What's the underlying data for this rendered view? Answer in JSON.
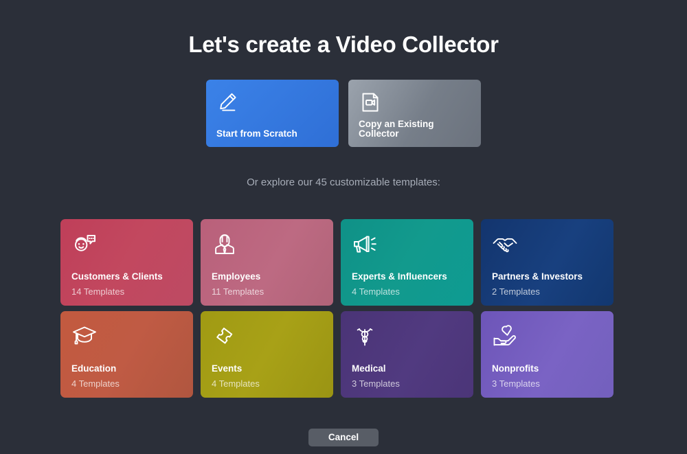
{
  "header": {
    "title": "Let's create a Video Collector"
  },
  "actions": [
    {
      "label": "Start from Scratch",
      "icon": "pencil-icon",
      "color": "#3b82e8",
      "key": "scratch"
    },
    {
      "label": "Copy an Existing Collector",
      "icon": "video-document-icon",
      "color": "#767e89",
      "key": "copy"
    }
  ],
  "subtitle": "Or explore our 45 customizable templates:",
  "templates": [
    {
      "title": "Customers & Clients",
      "count": "14 Templates",
      "icon": "smiley-chat-icon",
      "color": "#c2485f",
      "key": "customers"
    },
    {
      "title": "Employees",
      "count": "11 Templates",
      "icon": "employee-person-icon",
      "color": "#bd6a82",
      "key": "employees"
    },
    {
      "title": "Experts & Influencers",
      "count": "4 Templates",
      "icon": "megaphone-icon",
      "color": "#129a8d",
      "key": "experts"
    },
    {
      "title": "Partners & Investors",
      "count": "2 Templates",
      "icon": "handshake-icon",
      "color": "#18407f",
      "key": "partners"
    },
    {
      "title": "Education",
      "count": "4 Templates",
      "icon": "graduation-cap-icon",
      "color": "#c05b44",
      "key": "education"
    },
    {
      "title": "Events",
      "count": "4 Templates",
      "icon": "ticket-icon",
      "color": "#a8a117",
      "key": "events"
    },
    {
      "title": "Medical",
      "count": "3 Templates",
      "icon": "caduceus-icon",
      "color": "#513a80",
      "key": "medical"
    },
    {
      "title": "Nonprofits",
      "count": "3 Templates",
      "icon": "hand-heart-icon",
      "color": "#7a63c4",
      "key": "nonprofits"
    }
  ],
  "footer": {
    "cancel_label": "Cancel"
  },
  "theme": {
    "background": "#2b2f39",
    "text": "#ffffff",
    "muted_text": "#a7adb8",
    "cancel_bg": "#585d66"
  }
}
